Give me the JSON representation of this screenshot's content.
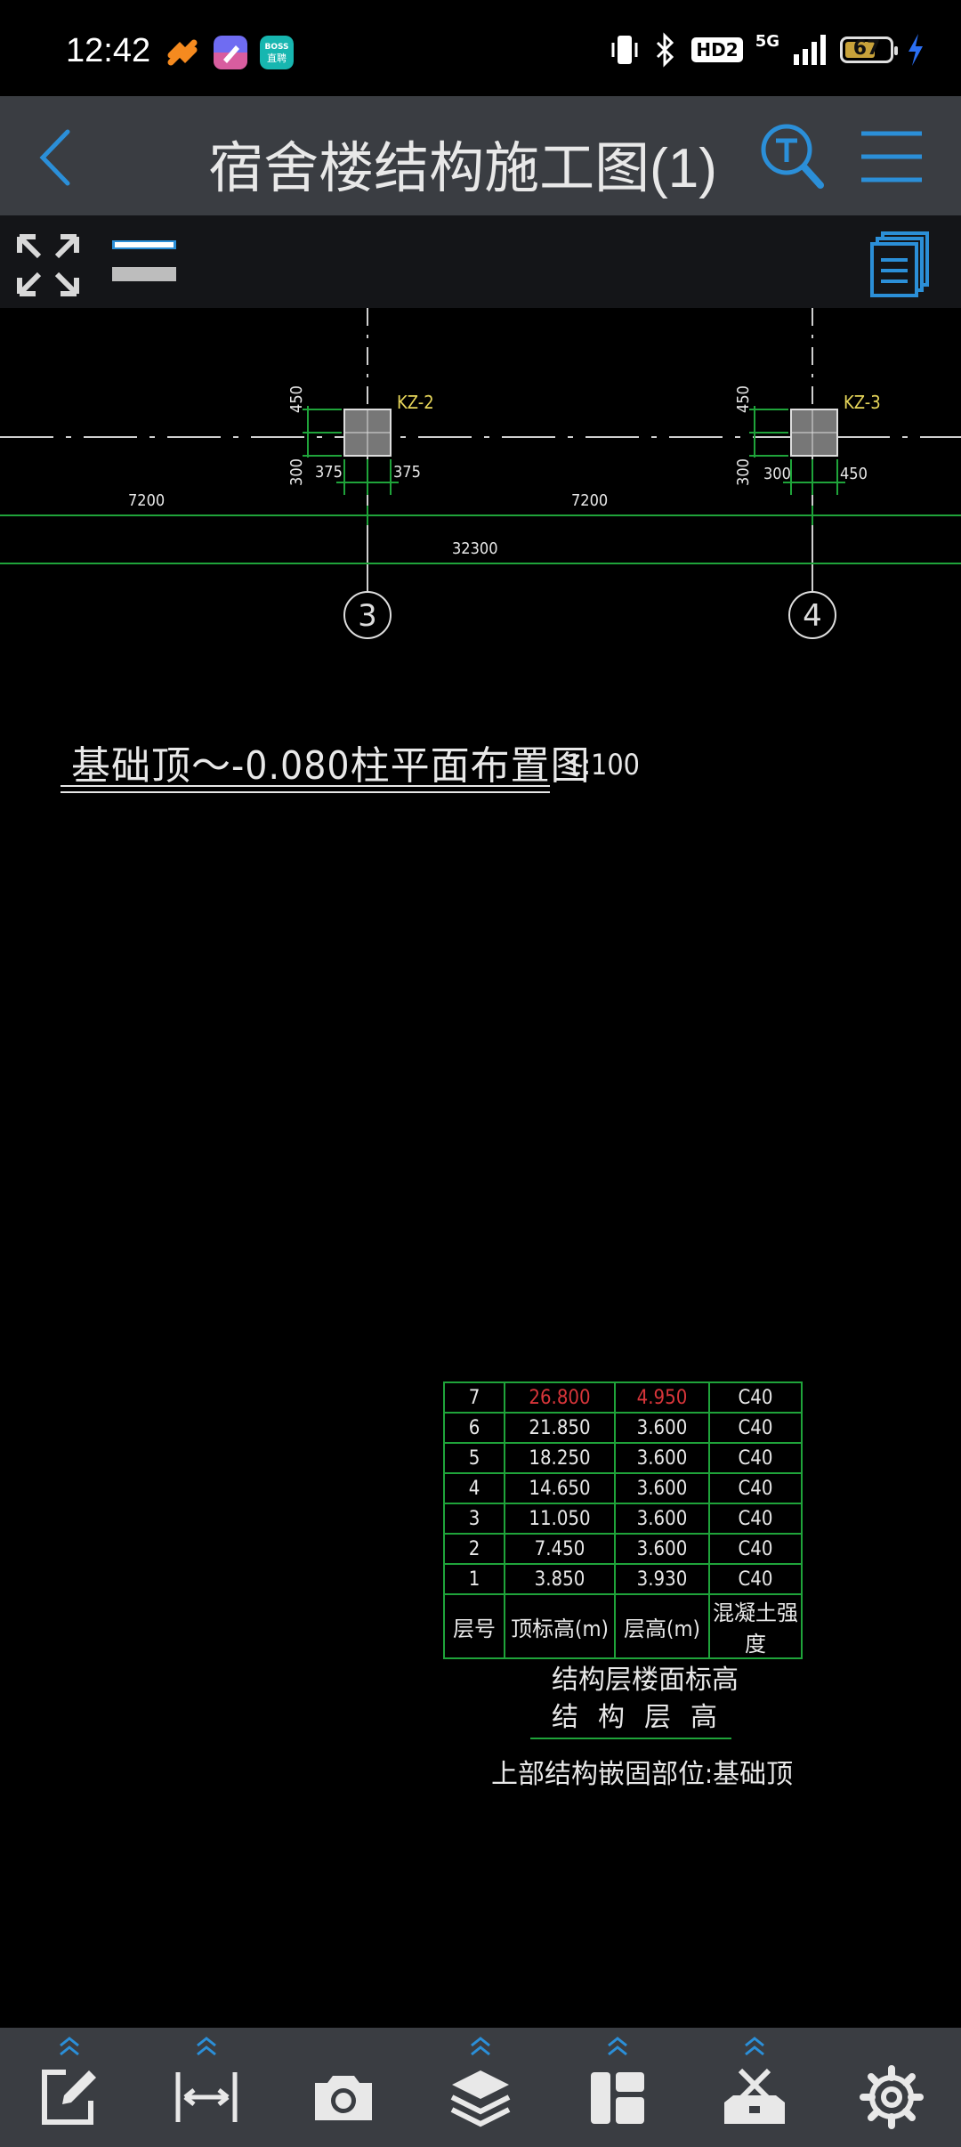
{
  "status_bar": {
    "time": "12:42",
    "battery": "67",
    "hd_label": "HD2",
    "network": "5G"
  },
  "header": {
    "title": "宿舍楼结构施工图(1)"
  },
  "drawing": {
    "columns": [
      "KZ-2",
      "KZ-3"
    ],
    "dim_kz2_top": "450",
    "dim_kz2_bottom": "300",
    "dim_kz2_left": "375",
    "dim_kz2_right": "375",
    "dim_kz3_top": "450",
    "dim_kz3_bottom": "300",
    "dim_kz3_left": "300",
    "dim_kz3_right": "450",
    "span_left": "7200",
    "span_right": "7200",
    "total": "32300",
    "axis_3": "3",
    "axis_4": "4",
    "plan_title": "基础顶～-0.080柱平面布置图",
    "scale": "1:100",
    "floor_table": {
      "rows": [
        {
          "floor": "7",
          "top_elev": "26.800",
          "height": "4.950",
          "grade": "C40"
        },
        {
          "floor": "6",
          "top_elev": "21.850",
          "height": "3.600",
          "grade": "C40"
        },
        {
          "floor": "5",
          "top_elev": "18.250",
          "height": "3.600",
          "grade": "C40"
        },
        {
          "floor": "4",
          "top_elev": "14.650",
          "height": "3.600",
          "grade": "C40"
        },
        {
          "floor": "3",
          "top_elev": "11.050",
          "height": "3.600",
          "grade": "C40"
        },
        {
          "floor": "2",
          "top_elev": "7.450",
          "height": "3.600",
          "grade": "C40"
        },
        {
          "floor": "1",
          "top_elev": "3.850",
          "height": "3.930",
          "grade": "C40"
        }
      ],
      "headers": [
        "层号",
        "顶标高(m)",
        "层高(m)",
        "混凝土强度"
      ]
    },
    "caption_1": "结构层楼面标高",
    "caption_2": "结构层高",
    "caption_3": "上部结构嵌固部位:基础顶"
  },
  "colors": {
    "header_bg": "#3a3d42",
    "accent_blue": "#2b8fd8",
    "cad_green": "#1fa33a",
    "cad_yellow": "#e7d65a",
    "cad_red": "#d8353a"
  }
}
